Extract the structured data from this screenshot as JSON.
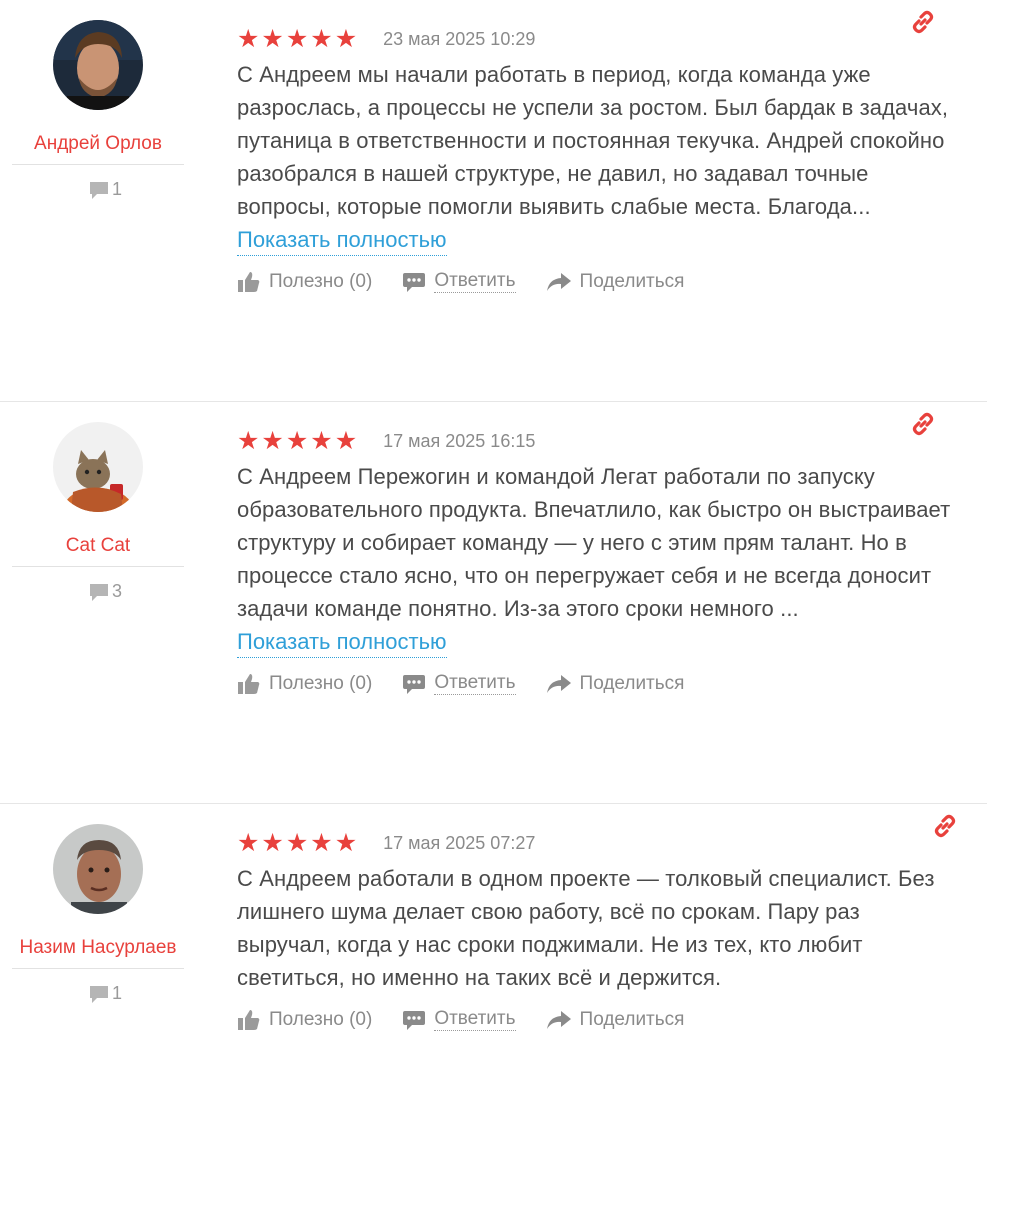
{
  "reviews": [
    {
      "author": "Андрей Орлов",
      "count": "1",
      "stars": 5,
      "date": "23 мая 2025 10:29",
      "text": "С Андреем мы начали работать в период, когда команда уже разрослась, а процессы не успели за ростом. Был бардак в задачах, путаница в ответственности и постоянная текучка. Андрей спокойно разобрался в нашей структуре, не давил, но задавал точные вопросы, которые помогли выявить слабые места. Благода...",
      "show_more": "Показать полностью",
      "useful": "Полезно (0)",
      "reply": "Ответить",
      "share": "Поделиться"
    },
    {
      "author": "Cat Cat",
      "count": "3",
      "stars": 5,
      "date": "17 мая 2025 16:15",
      "text": "С Андреем Пережогин и командой Легат работали по запуску образовательного продукта. Впечатлило, как быстро он выстраивает структуру и собирает команду — у него с этим прям талант. Но в процессе стало ясно, что он перегружает себя и не всегда доносит задачи команде понятно. Из-за этого сроки немного ...",
      "show_more": "Показать полностью",
      "useful": "Полезно (0)",
      "reply": "Ответить",
      "share": "Поделиться"
    },
    {
      "author": "Назим Насурлаев",
      "count": "1",
      "stars": 5,
      "date": "17 мая 2025 07:27",
      "text": "С Андреем работали в одном проекте — толковый специалист. Без лишнего шума делает свою работу, всё по срокам. Пару раз выручал, когда у нас сроки поджимали. Не из тех, кто любит светиться, но именно на таких всё и держится.",
      "useful": "Полезно (0)",
      "reply": "Ответить",
      "share": "Поделиться"
    }
  ],
  "colors": {
    "accent": "#e8413c",
    "link": "#2f9fd8",
    "muted": "#8a8a8a"
  },
  "icons": [
    "star-icon",
    "link-icon",
    "comment-icon",
    "thumbs-up-icon",
    "reply-bubble-icon",
    "share-arrow-icon"
  ]
}
